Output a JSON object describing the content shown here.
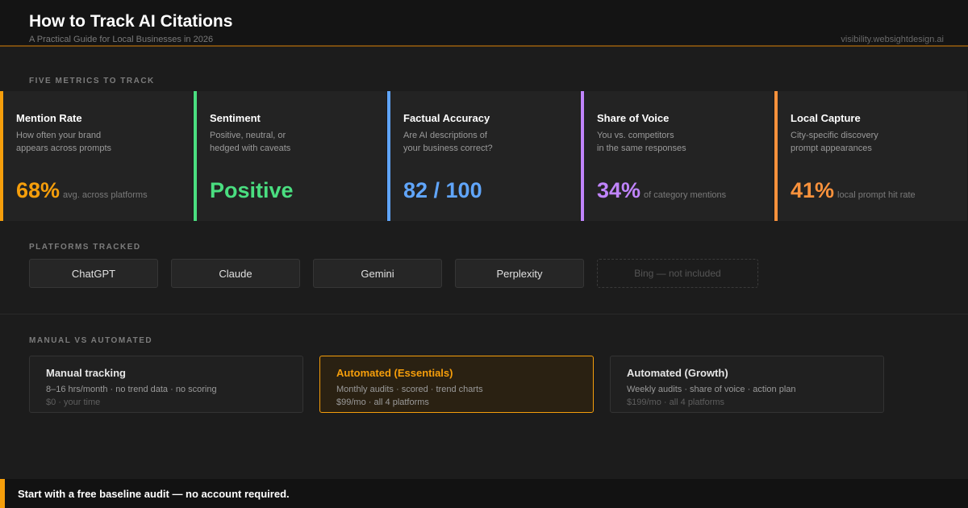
{
  "header": {
    "title": "How to Track AI Citations",
    "subtitle": "A Practical Guide for Local Businesses in 2026",
    "domain": "visibility.websightdesign.ai"
  },
  "sections": {
    "metrics_label": "FIVE METRICS TO TRACK",
    "platforms_label": "PLATFORMS TRACKED",
    "plans_label": "MANUAL VS AUTOMATED"
  },
  "metrics": [
    {
      "title": "Mention Rate",
      "desc_line1": "How often your brand",
      "desc_line2": "appears across prompts",
      "value": "68%",
      "note": "avg. across platforms",
      "color": "#f59e0b"
    },
    {
      "title": "Sentiment",
      "desc_line1": "Positive, neutral, or",
      "desc_line2": "hedged with caveats",
      "value": "Positive",
      "note": "",
      "color": "#4ade80"
    },
    {
      "title": "Factual Accuracy",
      "desc_line1": "Are AI descriptions of",
      "desc_line2": "your business correct?",
      "value": "82 / 100",
      "note": "",
      "color": "#60a5fa"
    },
    {
      "title": "Share of Voice",
      "desc_line1": "You vs. competitors",
      "desc_line2": "in the same responses",
      "value": "34%",
      "note": "of category mentions",
      "color": "#c084fc"
    },
    {
      "title": "Local Capture",
      "desc_line1": "City-specific discovery",
      "desc_line2": "prompt appearances",
      "value": "41%",
      "note": "local prompt hit rate",
      "color": "#fb923c"
    }
  ],
  "platforms": [
    "ChatGPT",
    "Claude",
    "Gemini",
    "Perplexity"
  ],
  "excluded_platform": "Bing — not included",
  "plans": [
    {
      "title": "Manual tracking",
      "features": "8–16 hrs/month · no trend data · no scoring",
      "price": "$0 · your time"
    },
    {
      "title": "Automated (Essentials)",
      "features": "Monthly audits · scored · trend charts",
      "price": "$99/mo · all 4 platforms"
    },
    {
      "title": "Automated (Growth)",
      "features": "Weekly audits · share of voice · action plan",
      "price": "$199/mo · all 4 platforms"
    }
  ],
  "footer": {
    "cta": "Start with a free baseline audit — no account required."
  },
  "colors": {
    "accent": "#f59e0b",
    "background": "#1c1c1c"
  }
}
